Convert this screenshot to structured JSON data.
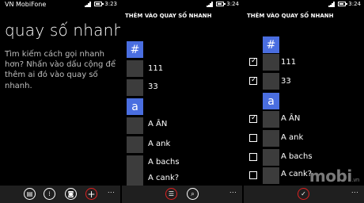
{
  "panel1": {
    "carrier": "VN MobiFone",
    "time": "3:23",
    "title": "quay số nhanh",
    "description": "Tìm kiếm cách gọi nhanh hơn? Nhấn vào dấu cộng để thêm ai đó vào quay số nhanh.",
    "appbar": {
      "buttons": [
        {
          "icon": "keyboard-icon",
          "glyph": "▤"
        },
        {
          "icon": "dialpad-icon",
          "glyph": "⁞"
        },
        {
          "icon": "voicemail-icon",
          "glyph": "◙"
        },
        {
          "icon": "add-icon",
          "glyph": "+"
        }
      ],
      "more": "..."
    }
  },
  "panel2": {
    "time": "3:24",
    "header": "THÊM VÀO QUAY SỐ NHANH",
    "groups": [
      {
        "label": "#",
        "items": [
          "111",
          "33"
        ]
      },
      {
        "label": "a",
        "items": [
          "A ÂN",
          "A ank",
          "A bachs",
          "A cank?"
        ]
      }
    ],
    "appbar": {
      "buttons": [
        {
          "icon": "select-list-icon",
          "glyph": "☰"
        },
        {
          "icon": "search-icon",
          "glyph": "⌕"
        }
      ],
      "more": "..."
    }
  },
  "panel3": {
    "time": "3:24",
    "header": "THÊM VÀO QUAY SỐ NHANH",
    "groups": [
      {
        "label": "#",
        "items": [
          {
            "name": "111",
            "checked": true
          },
          {
            "name": "33",
            "checked": true
          }
        ]
      },
      {
        "label": "a",
        "items": [
          {
            "name": "A ÂN",
            "checked": true
          },
          {
            "name": "A ank",
            "checked": false
          },
          {
            "name": "A bachs",
            "checked": false
          },
          {
            "name": "A cank?",
            "checked": false
          }
        ]
      }
    ],
    "appbar": {
      "buttons": [
        {
          "icon": "confirm-check-icon",
          "glyph": "✓"
        }
      ],
      "more": "..."
    }
  },
  "watermark": {
    "text": "mobi",
    "sub": ".vn"
  },
  "colors": {
    "accent": "#4a6ee0",
    "background": "#000000",
    "appbar": "#1f1f1f",
    "highlight_ring": "#dd2222"
  }
}
